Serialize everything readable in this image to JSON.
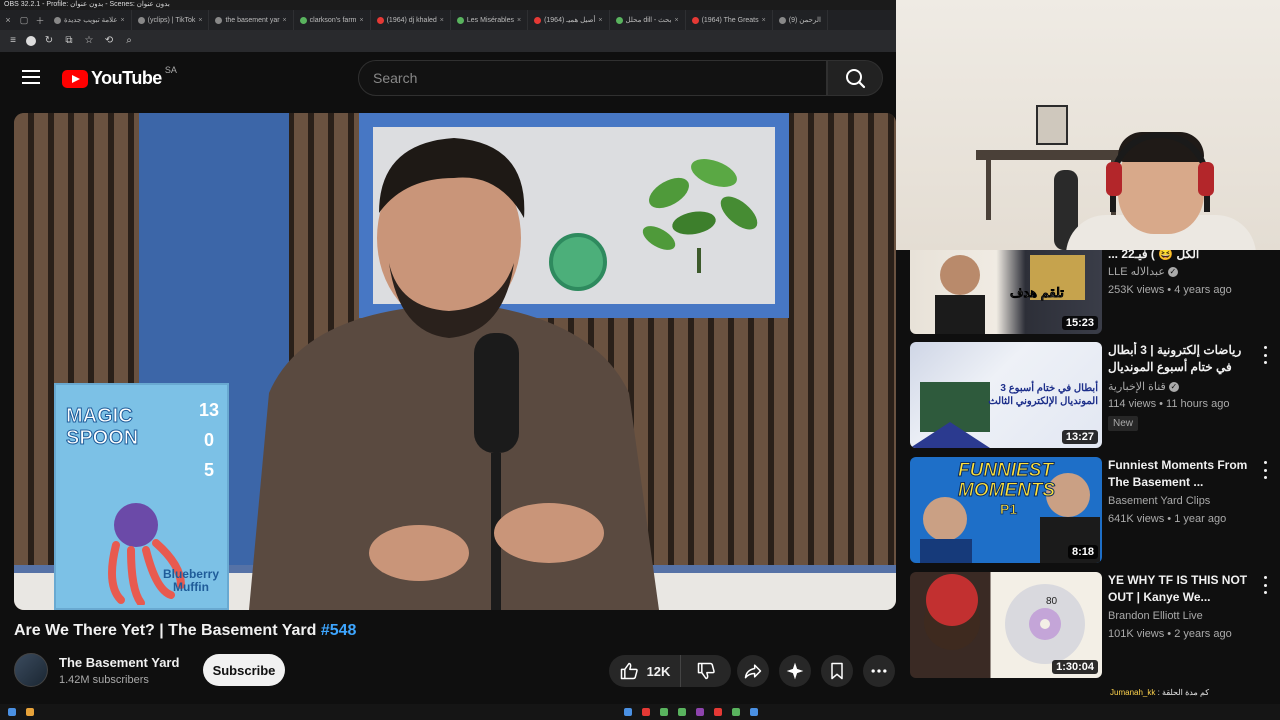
{
  "obs": {
    "title": "OBS 32.2.1 - Profile: بدون عنوان - Scenes: بدون عنوان"
  },
  "browser": {
    "tabs": [
      {
        "label": "علامة تبويب جديدة",
        "icon": "globe-icon",
        "favicon_color": "#888888"
      },
      {
        "label": "(yclips) | TikTok",
        "icon": "tiktok-icon",
        "favicon_color": "#888888"
      },
      {
        "label": "the basement yar",
        "icon": "globe-icon",
        "favicon_color": "#888888"
      },
      {
        "label": "clarkson's farm",
        "icon": "globe-icon",
        "favicon_color": "#59b35e"
      },
      {
        "label": "(1964) dj khaled",
        "icon": "youtube-icon",
        "favicon_color": "#e53935"
      },
      {
        "label": "Les Misérables",
        "icon": "globe-icon",
        "favicon_color": "#59b35e"
      },
      {
        "label": "(1964) أصيل هميـ",
        "icon": "youtube-icon",
        "favicon_color": "#e53935"
      },
      {
        "label": "محلل dill - بحث",
        "icon": "globe-icon",
        "favicon_color": "#59b35e"
      },
      {
        "label": "(1964) The Greats",
        "icon": "youtube-icon",
        "favicon_color": "#e53935"
      },
      {
        "label": "الرحمن (9)",
        "icon": "globe-icon",
        "favicon_color": "#888888"
      }
    ]
  },
  "header": {
    "logo_text": "YouTube",
    "country_code": "SA",
    "search_placeholder": "Search"
  },
  "video": {
    "title_main": "Are We There Yet? | The Basement Yard ",
    "title_tag": "#548",
    "cereal": {
      "brand_line1": "MAGIC",
      "brand_line2": "SPOON",
      "stat1": "13",
      "stat2": "0",
      "stat3": "5",
      "flavor_line1": "Blueberry",
      "flavor_line2": "Muffin"
    }
  },
  "channel": {
    "name": "The Basement Yard",
    "subscribers": "1.42M subscribers",
    "subscribe_label": "Subscribe"
  },
  "actions": {
    "like_count": "12K"
  },
  "recommendations": [
    {
      "title": "... الكل 😆 ) فيـ22",
      "channel": "LLE عبدالاله",
      "verified": true,
      "meta": "253K views • 4 years ago",
      "duration": "15:23",
      "overlay_text": "تلقم هدف",
      "new": false
    },
    {
      "title": "رياضات إلكترونية | 3 أبطال في ختام أسبوع المونديال الثالث",
      "channel": "قناة الإخبارية",
      "verified": true,
      "meta": "114 views • 11 hours ago",
      "duration": "13:27",
      "overlay_text": "3 أبطال في ختام أسبوع المونديال الإلكتروني الثالث",
      "new": true,
      "new_label": "New"
    },
    {
      "title": "Funniest Moments From The Basement ...",
      "channel": "Basement Yard Clips",
      "verified": false,
      "meta": "641K views • 1 year ago",
      "duration": "8:18",
      "overlay_text": "FUNNIEST MOMENTS",
      "overlay_sub": "P1",
      "new": false
    },
    {
      "title": "YE WHY TF IS THIS NOT OUT | Kanye We...",
      "channel": "Brandon Elliott Live",
      "verified": false,
      "meta": "101K views • 2 years ago",
      "duration": "1:30:04",
      "overlay_text": "80",
      "new": false
    }
  ],
  "chat_overlay": {
    "name": "Jumanah_kk",
    "text": ": كم مدة الحلقة"
  },
  "colors": {
    "yt_red": "#ff0000",
    "accent_blue": "#3ea6ff",
    "bg": "#0f0f0f"
  }
}
